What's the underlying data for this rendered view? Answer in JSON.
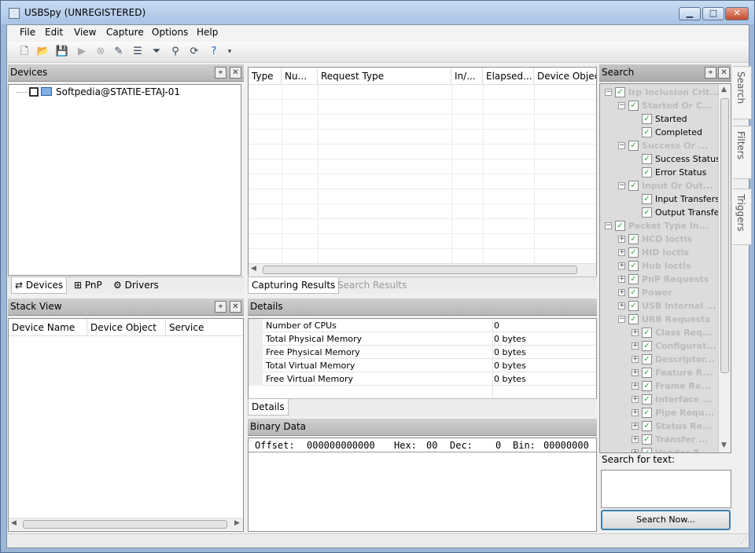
{
  "window": {
    "title": "USBSpy (UNREGISTERED)",
    "minimize": "▁",
    "maximize": "□",
    "close": "✕"
  },
  "menu": [
    "File",
    "Edit",
    "View",
    "Capture",
    "Options",
    "Help"
  ],
  "toolbar_icons": [
    "new-icon",
    "open-icon",
    "save-icon",
    "play-icon",
    "stop-icon",
    "edit-icon",
    "list-icon",
    "filter-icon",
    "find-icon",
    "refresh-icon",
    "help-icon"
  ],
  "devices_pane": {
    "title": "Devices",
    "tree_item": "Softpedia@STATIE-ETAJ-01",
    "tabs": [
      "Devices",
      "PnP",
      "Drivers"
    ]
  },
  "stack_pane": {
    "title": "Stack View",
    "columns": [
      "Device Name",
      "Device Object",
      "Service"
    ]
  },
  "capture_grid": {
    "columns": [
      "Type",
      "Nu...",
      "Request Type",
      "In/...",
      "Elapsed...",
      "Device Object"
    ],
    "tabs": [
      "Capturing Results",
      "Search Results"
    ]
  },
  "details_pane": {
    "title": "Details",
    "rows": [
      {
        "key": "Number of CPUs",
        "value": "0"
      },
      {
        "key": "Total Physical Memory",
        "value": "0 bytes"
      },
      {
        "key": "Free Physical Memory",
        "value": "0 bytes"
      },
      {
        "key": "Total Virtual Memory",
        "value": "0 bytes"
      },
      {
        "key": "Free Virtual Memory",
        "value": "0 bytes"
      }
    ],
    "tab": "Details"
  },
  "binary_pane": {
    "title": "Binary Data",
    "offset_label": "Offset:",
    "offset_value": "000000000000",
    "hex_label": "Hex:",
    "hex_value": "00",
    "dec_label": "Dec:",
    "dec_value": "0",
    "bin_label": "Bin:",
    "bin_value": "00000000"
  },
  "search_pane": {
    "title": "Search",
    "tree": [
      {
        "label": "Irp Inclusion Crit...",
        "level": 0,
        "dim": true,
        "exp": "−"
      },
      {
        "label": "Started Or C...",
        "level": 1,
        "dim": true,
        "exp": "−"
      },
      {
        "label": "Started",
        "level": 2,
        "dim": false,
        "exp": ""
      },
      {
        "label": "Completed",
        "level": 2,
        "dim": false,
        "exp": ""
      },
      {
        "label": "Success Or ...",
        "level": 1,
        "dim": true,
        "exp": "−"
      },
      {
        "label": "Success Status",
        "level": 2,
        "dim": false,
        "exp": ""
      },
      {
        "label": "Error Status",
        "level": 2,
        "dim": false,
        "exp": ""
      },
      {
        "label": "Input Or Out...",
        "level": 1,
        "dim": true,
        "exp": "−"
      },
      {
        "label": "Input Transfers",
        "level": 2,
        "dim": false,
        "exp": ""
      },
      {
        "label": "Output Transfers",
        "level": 2,
        "dim": false,
        "exp": ""
      },
      {
        "label": "Packet Type In...",
        "level": 0,
        "dim": true,
        "exp": "−"
      },
      {
        "label": "HCD Ioctls",
        "level": 1,
        "dim": true,
        "exp": "+"
      },
      {
        "label": "HID Ioctls",
        "level": 1,
        "dim": true,
        "exp": "+"
      },
      {
        "label": "Hub Ioctls",
        "level": 1,
        "dim": true,
        "exp": "+"
      },
      {
        "label": "PnP Requests",
        "level": 1,
        "dim": true,
        "exp": "+"
      },
      {
        "label": "Power",
        "level": 1,
        "dim": true,
        "exp": "+"
      },
      {
        "label": "USB Internal ...",
        "level": 1,
        "dim": true,
        "exp": "+"
      },
      {
        "label": "URB Requests",
        "level": 1,
        "dim": true,
        "exp": "−"
      },
      {
        "label": "Class Req...",
        "level": 2,
        "dim": true,
        "exp": "+"
      },
      {
        "label": "Configurat...",
        "level": 2,
        "dim": true,
        "exp": "+"
      },
      {
        "label": "Descriptor...",
        "level": 2,
        "dim": true,
        "exp": "+"
      },
      {
        "label": "Feature R...",
        "level": 2,
        "dim": true,
        "exp": "+"
      },
      {
        "label": "Frame Re...",
        "level": 2,
        "dim": true,
        "exp": "+"
      },
      {
        "label": "Interface ...",
        "level": 2,
        "dim": true,
        "exp": "+"
      },
      {
        "label": "Pipe Requ...",
        "level": 2,
        "dim": true,
        "exp": "+"
      },
      {
        "label": "Status Re...",
        "level": 2,
        "dim": true,
        "exp": "+"
      },
      {
        "label": "Transfer ...",
        "level": 2,
        "dim": true,
        "exp": "+"
      },
      {
        "label": "Vendor R...",
        "level": 2,
        "dim": true,
        "exp": "+"
      }
    ],
    "search_for_text_label": "Search for text:",
    "search_button": "Search Now..."
  },
  "side_tabs": [
    "Search",
    "Filters",
    "Triggers"
  ]
}
